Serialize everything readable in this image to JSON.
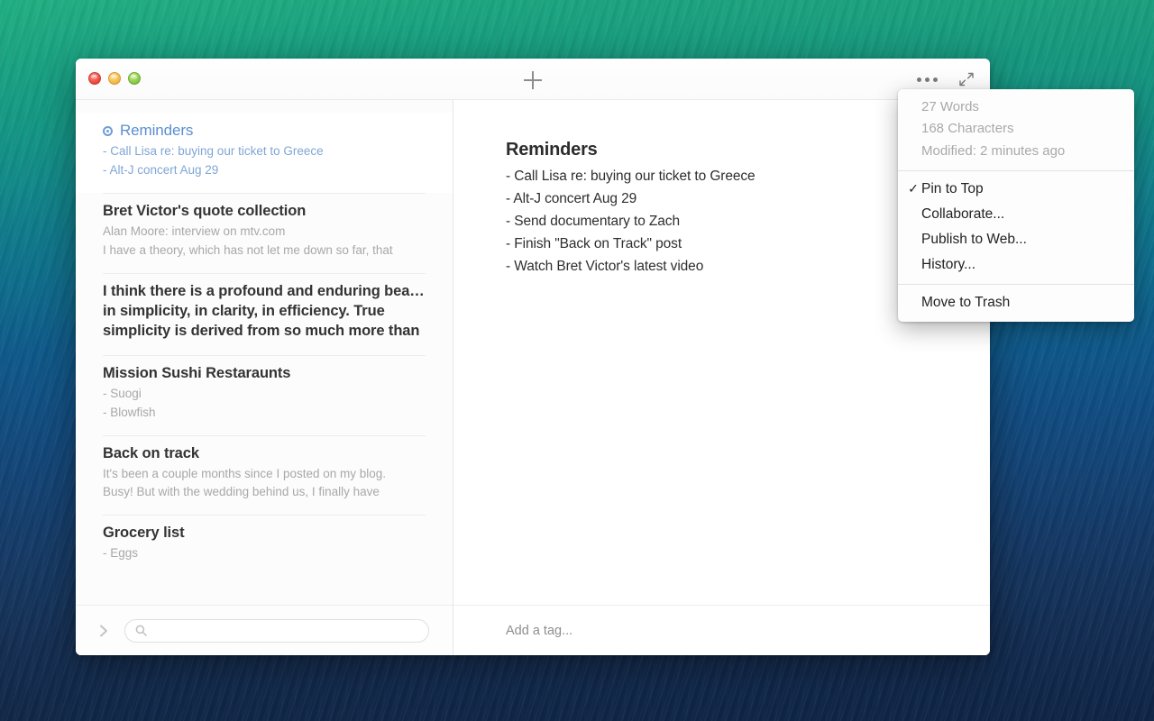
{
  "window": {
    "traffic_lights": [
      "close",
      "minimize",
      "zoom"
    ],
    "new_note_icon": "plus-icon",
    "overflow_icon": "ellipsis-icon",
    "expand_icon": "expand-diagonal-icon"
  },
  "sidebar": {
    "notes": [
      {
        "title": "Reminders",
        "selected": true,
        "pinned": true,
        "preview": [
          "- Call Lisa re: buying our ticket to Greece",
          "- Alt-J concert Aug 29"
        ]
      },
      {
        "title": "Bret Victor's quote collection",
        "selected": false,
        "pinned": false,
        "preview": [
          "Alan Moore: interview on mtv.com",
          "I have a theory, which has not let me down so far, that"
        ]
      },
      {
        "title": "I think there is a profound and enduring beauty",
        "selected": false,
        "pinned": false,
        "preview": [
          "in simplicity, in clarity, in efficiency. True",
          "simplicity is derived from so much more than"
        ]
      },
      {
        "title": "Mission Sushi Restaraunts",
        "selected": false,
        "pinned": false,
        "preview": [
          "- Suogi",
          "- Blowfish"
        ]
      },
      {
        "title": "Back on track",
        "selected": false,
        "pinned": false,
        "preview": [
          "It's been a couple months since I posted on my blog.",
          "Busy! But with the wedding behind us, I finally have"
        ]
      },
      {
        "title": "Grocery list",
        "selected": false,
        "pinned": false,
        "preview": [
          "- Eggs"
        ]
      }
    ],
    "search": {
      "placeholder": "",
      "value": "",
      "icon": "search-icon",
      "toggle_icon": "chevron-right-icon"
    }
  },
  "editor": {
    "title": "Reminders",
    "lines": [
      "- Call Lisa re: buying our ticket to Greece",
      "- Alt-J concert Aug 29",
      "- Send documentary to Zach",
      "- Finish \"Back on Track\" post",
      "- Watch Bret Victor's latest video"
    ],
    "tag": {
      "placeholder": "Add a tag...",
      "value": ""
    }
  },
  "menu": {
    "info": {
      "words": "27 Words",
      "characters": "168 Characters",
      "modified": "Modified: 2 minutes ago"
    },
    "items": [
      {
        "label": "Pin to Top",
        "checked": true,
        "check_glyph": "✓"
      },
      {
        "label": "Collaborate...",
        "checked": false,
        "check_glyph": ""
      },
      {
        "label": "Publish to Web...",
        "checked": false,
        "check_glyph": ""
      },
      {
        "label": "History...",
        "checked": false,
        "check_glyph": ""
      }
    ],
    "trash": {
      "label": "Move to Trash"
    }
  },
  "colors": {
    "accent_blue": "#5a8fd0",
    "text_dark": "#2c2c2c",
    "muted": "#a8a8a8",
    "window_bg": "#ffffff",
    "sidebar_bg": "#fcfcfc"
  }
}
